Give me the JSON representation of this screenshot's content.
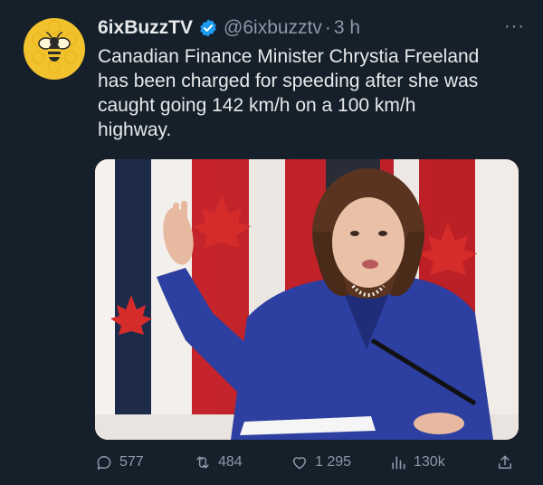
{
  "tweet": {
    "author_name": "6ixBuzzTV",
    "handle": "@6ixbuzztv",
    "separator": "·",
    "time": "3 h",
    "more_label": "···",
    "text": "Canadian Finance Minister Chrystia Freeland\nhas been charged for speeding after she was\ncaught going 142 km/h on a 100 km/h\nhighway.",
    "verified": true
  },
  "actions": {
    "replies": "577",
    "retweets": "484",
    "likes": "1 295",
    "views": "130k"
  },
  "icons": [
    "avatar-bee-logo",
    "verified-badge-icon",
    "more-icon",
    "reply-icon",
    "retweet-icon",
    "like-icon",
    "views-icon",
    "share-icon"
  ],
  "colors": {
    "background": "#15202b",
    "text": "#e7e9ea",
    "muted": "#8b98a5",
    "verified": "#1d9bf0",
    "avatar": "#f2c12e"
  }
}
